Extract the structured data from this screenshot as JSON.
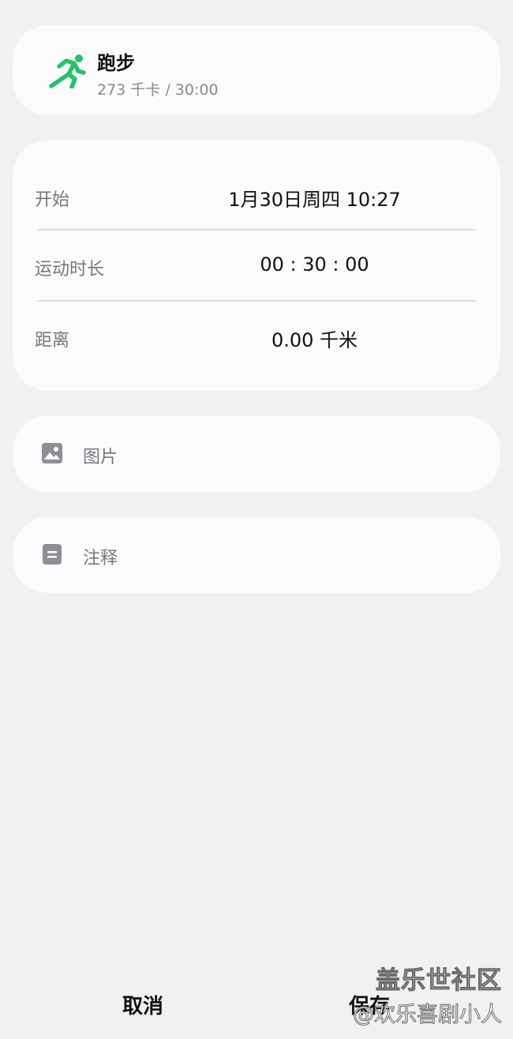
{
  "activity": {
    "icon": "running-person-icon",
    "title": "跑步",
    "summary": "273 千卡 / 30:00",
    "accent_color": "#23c26b"
  },
  "details": {
    "rows": [
      {
        "label": "开始",
        "value": "1月30日周四 10:27"
      },
      {
        "label": "运动时长",
        "value": "00 : 30 : 00"
      },
      {
        "label": "距离",
        "value": "0.00 千米"
      }
    ]
  },
  "photo": {
    "icon": "image-icon",
    "label": "图片"
  },
  "note": {
    "icon": "note-icon",
    "label": "注释"
  },
  "actions": {
    "cancel_label": "取消",
    "save_label": "保存"
  },
  "watermark": {
    "line1": "盖乐世社区",
    "line2": "@欢乐喜剧小人"
  }
}
